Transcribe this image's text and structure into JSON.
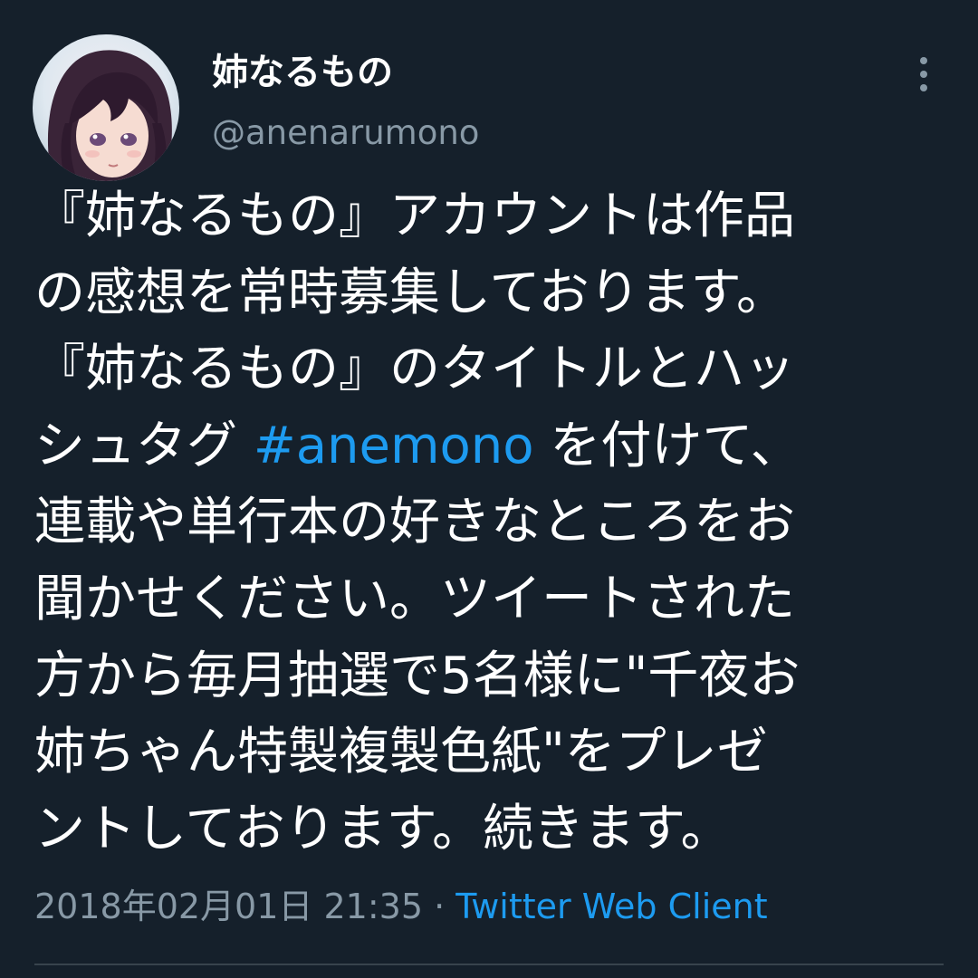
{
  "tweet": {
    "author": {
      "display_name": "姉なるもの",
      "handle": "@anenarumono",
      "avatar_icon": "user-avatar-illustration"
    },
    "more_icon": "more-vertical-icon",
    "text_lines": [
      {
        "before": "『姉なるもの』アカウントは作品",
        "hashtag": "",
        "after": ""
      },
      {
        "before": "の感想を常時募集しております。",
        "hashtag": "",
        "after": ""
      },
      {
        "before": "『姉なるもの』のタイトルとハッ",
        "hashtag": "",
        "after": ""
      },
      {
        "before": "シュタグ ",
        "hashtag": "#anemono",
        "after": " を付けて、"
      },
      {
        "before": "連載や単行本の好きなところをお",
        "hashtag": "",
        "after": ""
      },
      {
        "before": "聞かせください。ツイートされた",
        "hashtag": "",
        "after": ""
      },
      {
        "before": "方から毎月抽選で5名様に\"千夜お",
        "hashtag": "",
        "after": ""
      },
      {
        "before": "姉ちゃん特製複製色紙\"をプレゼ",
        "hashtag": "",
        "after": ""
      },
      {
        "before": "ントしております。続きます。",
        "hashtag": "",
        "after": ""
      }
    ],
    "timestamp": "2018年02月01日 21:35",
    "separator": " · ",
    "source": "Twitter Web Client"
  },
  "colors": {
    "background": "#15202b",
    "text": "#ffffff",
    "secondary": "#8899a6",
    "link": "#1d9bf0",
    "divider": "#38444d"
  }
}
